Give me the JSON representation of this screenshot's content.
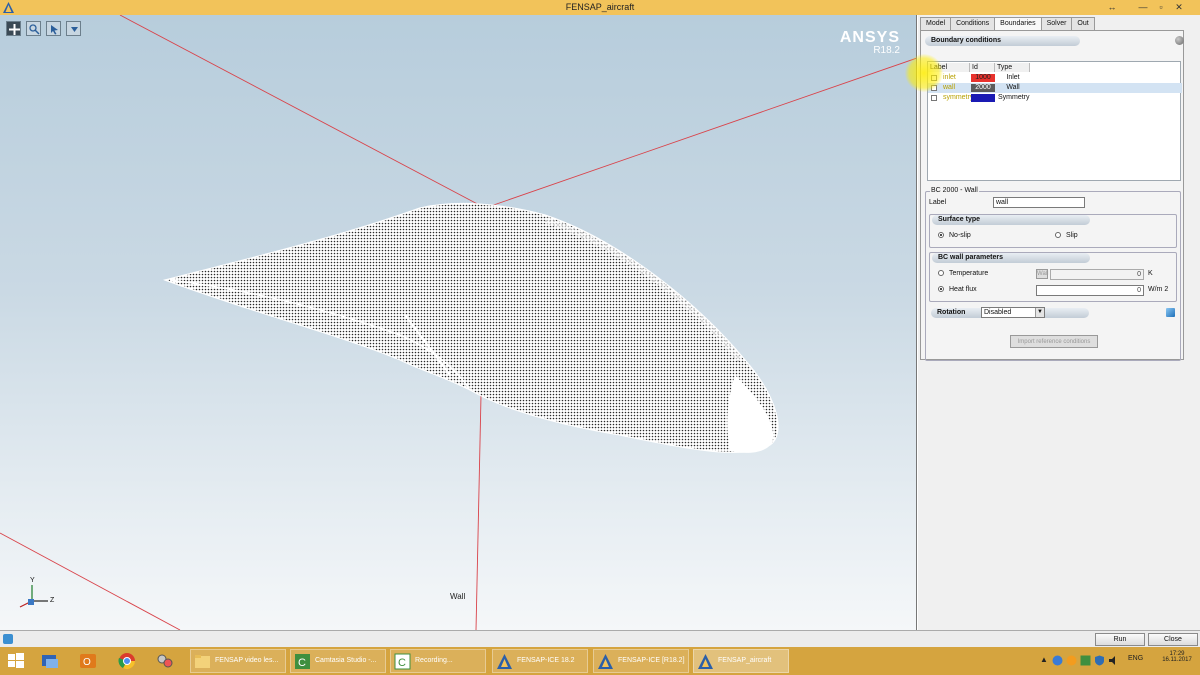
{
  "window": {
    "title": "FENSAP_aircraft"
  },
  "viewport": {
    "logo_line1": "ANSYS",
    "logo_line2": "R18.2",
    "surface_label": "Wall",
    "axis_y": "Y",
    "axis_z": "Z"
  },
  "tabs": [
    "Model",
    "Conditions",
    "Boundaries",
    "Solver",
    "Out"
  ],
  "active_tab": "Boundaries",
  "boundary_conditions": {
    "header": "Boundary conditions",
    "columns": [
      "Label",
      "Id",
      "Type"
    ],
    "rows": [
      {
        "label": "inlet",
        "id": "1000",
        "type": "Inlet",
        "color": "#e8322d"
      },
      {
        "label": "wall",
        "id": "2000",
        "type": "Wall",
        "color": "#5b5b5b"
      },
      {
        "label": "symmetry",
        "id": "",
        "type": "Symmetry",
        "color": "#1a1ab3"
      }
    ]
  },
  "bc_detail": {
    "frame_title": "BC 2000 - Wall",
    "label_caption": "Label",
    "label_value": "wall",
    "surface_type": {
      "header": "Surface type",
      "option_noslip": "No-slip",
      "option_slip": "Slip",
      "selected": "No-slip"
    },
    "wall_params": {
      "header": "BC wall parameters",
      "temperature_label": "Temperature",
      "temperature_btn": "Wall",
      "temperature_value": "0",
      "temperature_unit": "K",
      "heatflux_label": "Heat flux",
      "heatflux_value": "0",
      "heatflux_unit": "W/m 2",
      "selected": "Heat flux"
    },
    "rotation": {
      "label": "Rotation",
      "value": "Disabled"
    },
    "import_button": "Import reference conditions"
  },
  "footer": {
    "run": "Run",
    "close": "Close"
  },
  "taskbar": {
    "tasks": [
      {
        "title": "FENSAP video les...",
        "icon": "folder-icon"
      },
      {
        "title": "Camtasia Studio -...",
        "icon": "camtasia-icon"
      },
      {
        "title": "Recording...",
        "icon": "camtasia-recorder-icon"
      },
      {
        "title": "FENSAP-ICE 18.2",
        "icon": "fensap-icon"
      },
      {
        "title": "FENSAP-ICE [R18.2]",
        "icon": "fensap-icon"
      },
      {
        "title": "FENSAP_aircraft",
        "icon": "fensap-icon"
      }
    ],
    "language": "ENG",
    "time": "17:29",
    "date": "16.11.2017"
  }
}
